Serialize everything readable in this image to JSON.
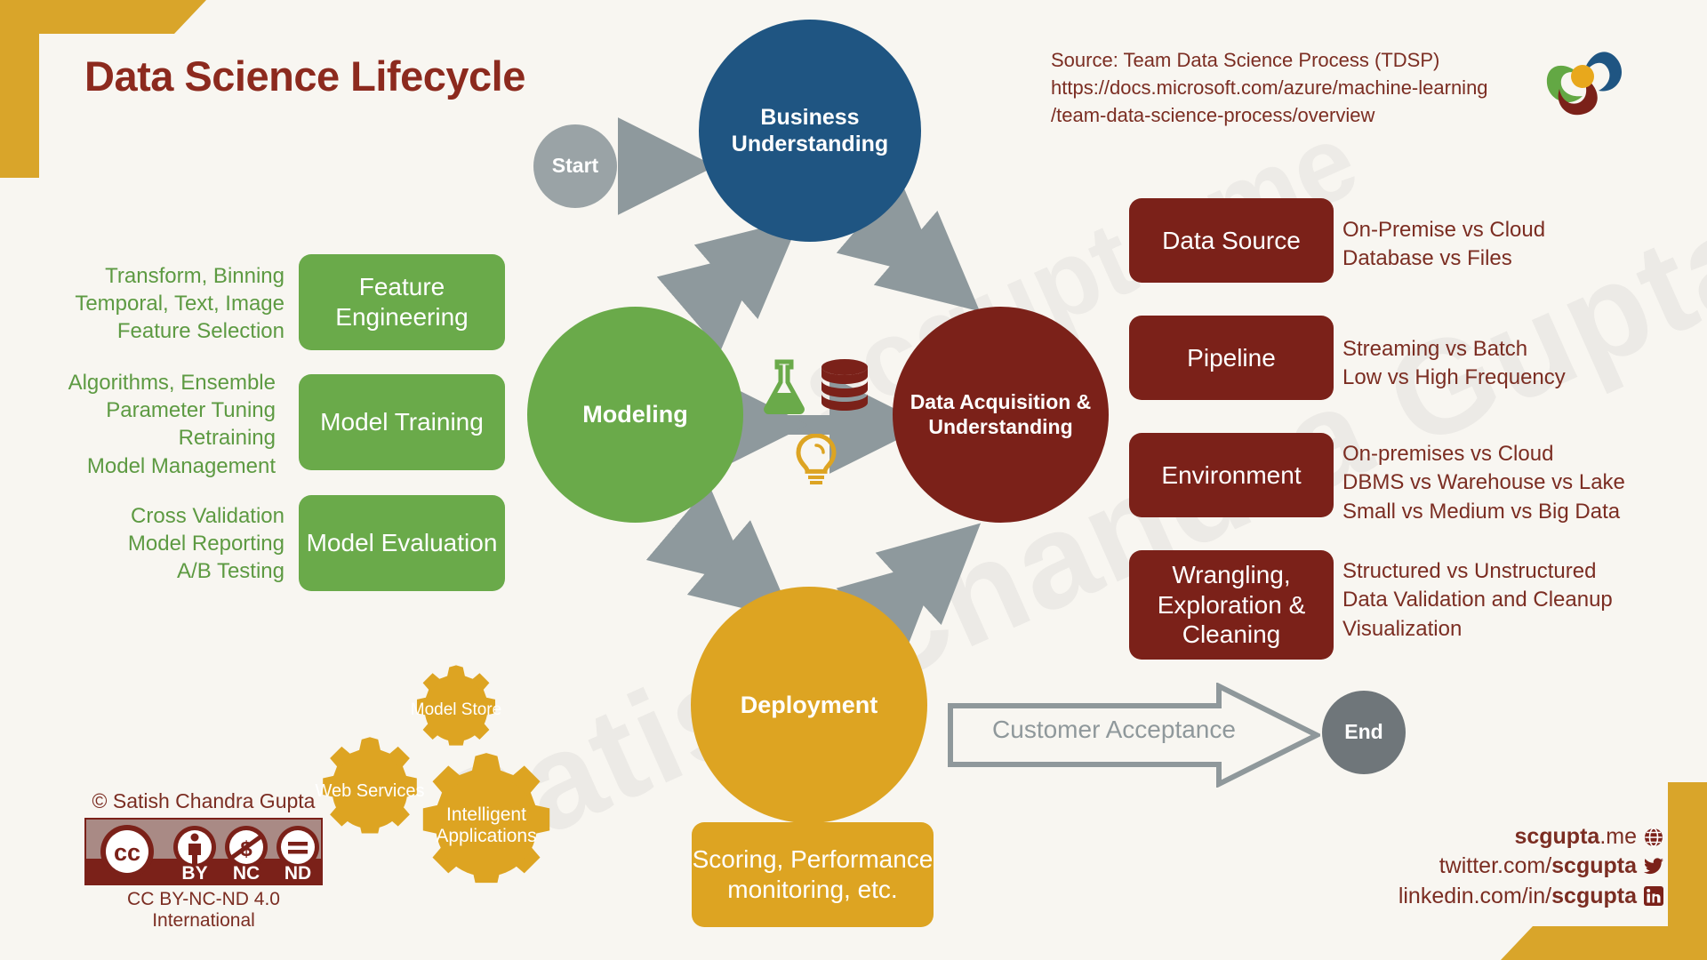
{
  "title": "Data Science Lifecycle",
  "source": {
    "line1": "Source: Team Data Science Process (TDSP)",
    "line2": "https://docs.microsoft.com/azure/machine-learning",
    "line3": "/team-data-science-process/overview"
  },
  "colors": {
    "blue": "#1f5582",
    "green": "#6aaa4a",
    "dark_red": "#7b2119",
    "gold": "#dda422",
    "gray": "#9aa3a6",
    "end_gray": "#6f767a",
    "title_red": "#8c2a1e",
    "background": "#f8f6f1",
    "arrow_gray": "#8e999d"
  },
  "flow": {
    "start_label": "Start",
    "end_label": "End",
    "customer_acceptance": "Customer Acceptance"
  },
  "circles": {
    "business_understanding": "Business Understanding",
    "modeling": "Modeling",
    "data_acquisition": "Data Acquisition & Understanding",
    "deployment": "Deployment"
  },
  "center_icons": [
    {
      "name": "flask-icon",
      "color": "#6aaa4a"
    },
    {
      "name": "database-icon",
      "color": "#7b2119"
    },
    {
      "name": "lightbulb-icon",
      "color": "#dda422"
    }
  ],
  "modeling_stages": [
    {
      "box": "Feature Engineering",
      "details": "Transform, Binning\nTemporal, Text, Image\nFeature Selection"
    },
    {
      "box": "Model Training",
      "details": "Algorithms, Ensemble\nParameter Tuning\nRetraining\nModel Management"
    },
    {
      "box": "Model Evaluation",
      "details": "Cross Validation\nModel Reporting\nA/B Testing"
    }
  ],
  "data_stages": [
    {
      "box": "Data Source",
      "details": "On-Premise vs Cloud\nDatabase vs Files"
    },
    {
      "box": "Pipeline",
      "details": "Streaming vs Batch\nLow vs High Frequency"
    },
    {
      "box": "Environment",
      "details": "On-premises vs Cloud\nDBMS vs Warehouse vs Lake\nSmall vs Medium vs Big Data"
    },
    {
      "box": "Wrangling, Exploration & Cleaning",
      "details": "Structured vs Unstructured\nData Validation and Cleanup\nVisualization"
    }
  ],
  "deployment": {
    "gears": [
      {
        "label": "Model Store"
      },
      {
        "label": "Web Services"
      },
      {
        "label": "Intelligent Applications"
      }
    ],
    "scoring_box": "Scoring, Performance monitoring, etc."
  },
  "license": {
    "copyright": "© Satish Chandra Gupta",
    "cc_mark": "cc",
    "badges": [
      "BY",
      "NC",
      "ND"
    ],
    "footer": "CC BY-NC-ND 4.0 International"
  },
  "social": [
    {
      "prefix": "",
      "bold": "scgupta",
      "suffix": ".me",
      "icon": "globe-icon"
    },
    {
      "prefix": "twitter.com/",
      "bold": "scgupta",
      "suffix": "",
      "icon": "twitter-icon"
    },
    {
      "prefix": "linkedin.com/in/",
      "bold": "scgupta",
      "suffix": "",
      "icon": "linkedin-icon"
    }
  ],
  "watermark": {
    "text1": "Satish Chandra Gupta",
    "text2": "scgupta.me"
  }
}
